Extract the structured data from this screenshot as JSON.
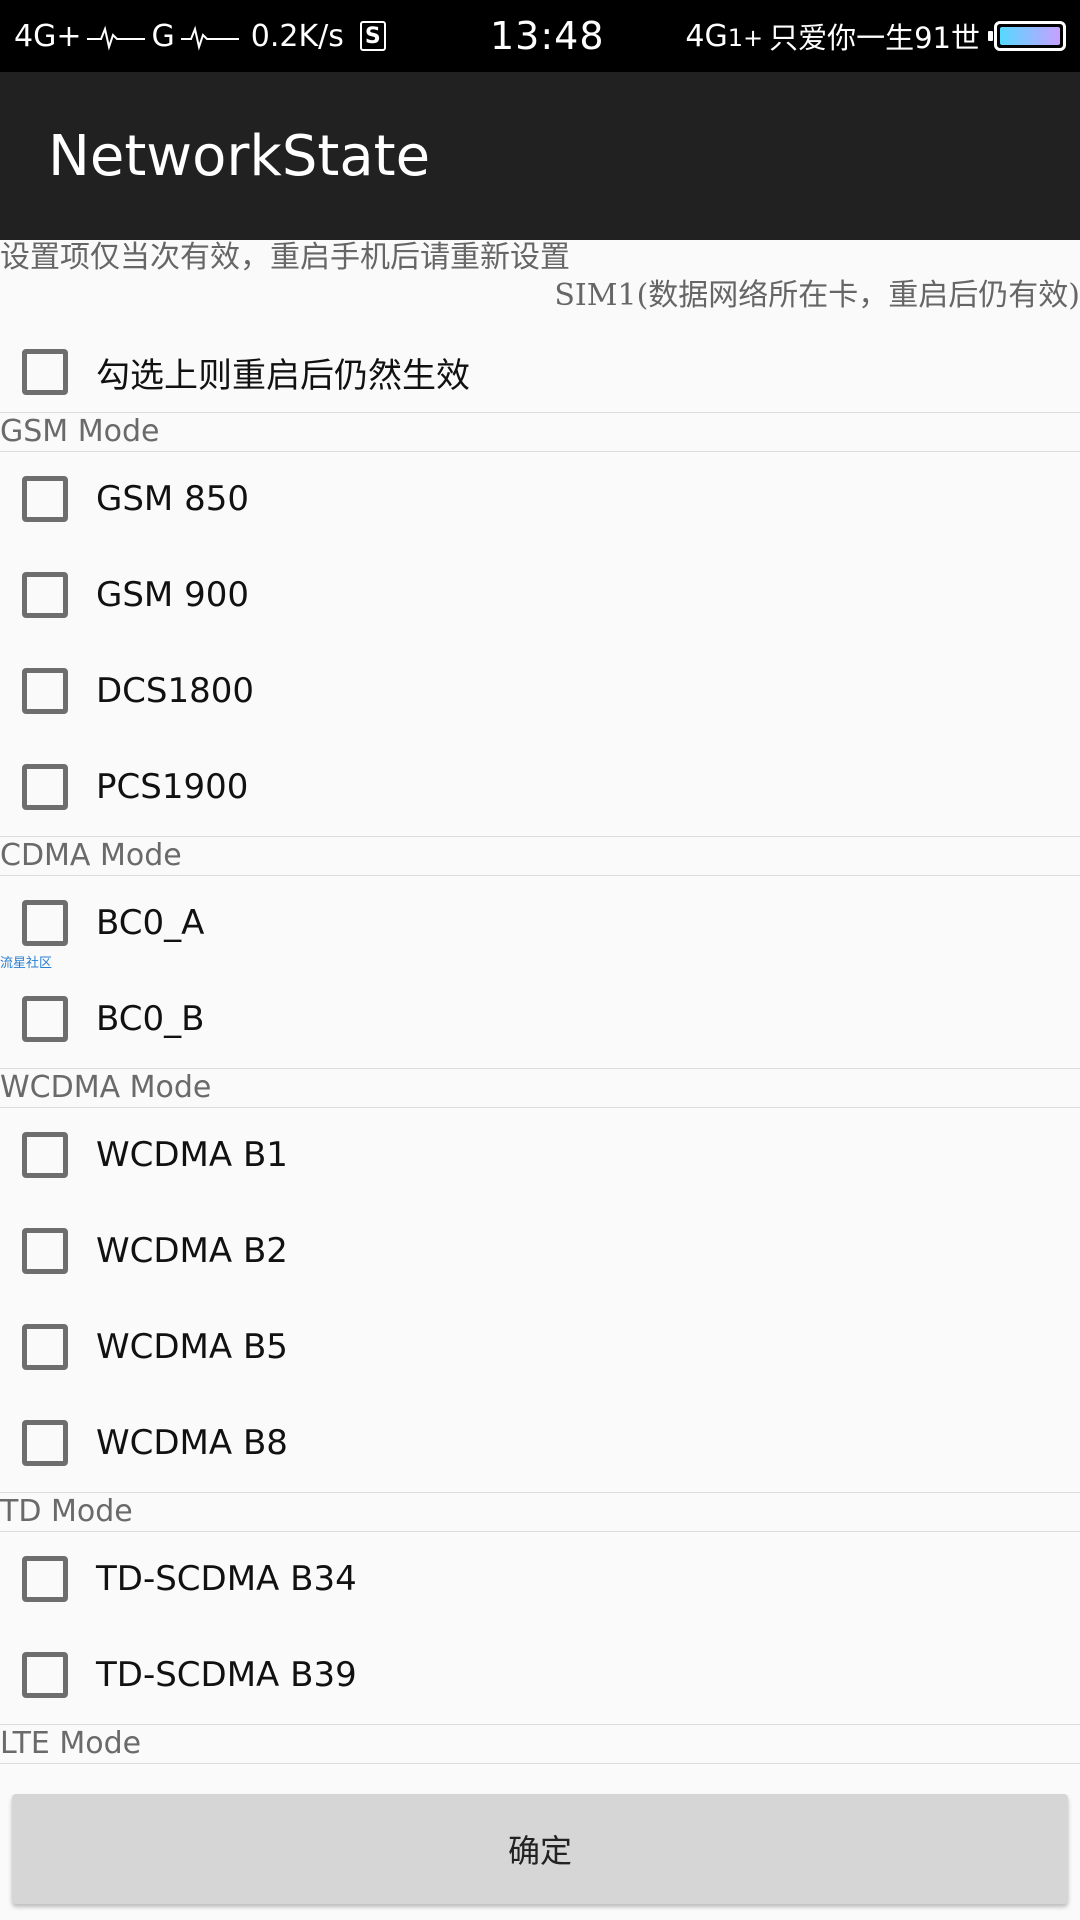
{
  "status_bar": {
    "net1": "4G+",
    "net2": "G",
    "speed": "0.2K/s",
    "s_icon": "S",
    "time": "13:48",
    "net3": "4G",
    "net3_sub": "1+",
    "carrier": "只爱你一生91世",
    "battery_color": "#56d8ff"
  },
  "app_bar": {
    "title": "NetworkState"
  },
  "notice": {
    "line1": "设置项仅当次有效，重启手机后请重新设置",
    "line2": "SIM1(数据网络所在卡，重启后仍有效)"
  },
  "persist_option": {
    "label": "勾选上则重启后仍然生效",
    "checked": false
  },
  "sections": [
    {
      "title": "GSM Mode",
      "items": [
        {
          "label": "GSM 850",
          "checked": false
        },
        {
          "label": "GSM 900",
          "checked": false
        },
        {
          "label": "DCS1800",
          "checked": false
        },
        {
          "label": "PCS1900",
          "checked": false
        }
      ]
    },
    {
      "title": "CDMA Mode",
      "items": [
        {
          "label": "BC0_A",
          "checked": false
        },
        {
          "label": "BC0_B",
          "checked": false
        }
      ]
    },
    {
      "title": "WCDMA Mode",
      "items": [
        {
          "label": "WCDMA B1",
          "checked": false
        },
        {
          "label": "WCDMA B2",
          "checked": false
        },
        {
          "label": "WCDMA B5",
          "checked": false
        },
        {
          "label": "WCDMA B8",
          "checked": false
        }
      ]
    },
    {
      "title": "TD Mode",
      "items": [
        {
          "label": "TD-SCDMA B34",
          "checked": false
        },
        {
          "label": "TD-SCDMA B39",
          "checked": false
        }
      ]
    },
    {
      "title": "LTE Mode",
      "items": []
    }
  ],
  "watermark": "流星社区",
  "confirm_button": {
    "label": "确定"
  }
}
